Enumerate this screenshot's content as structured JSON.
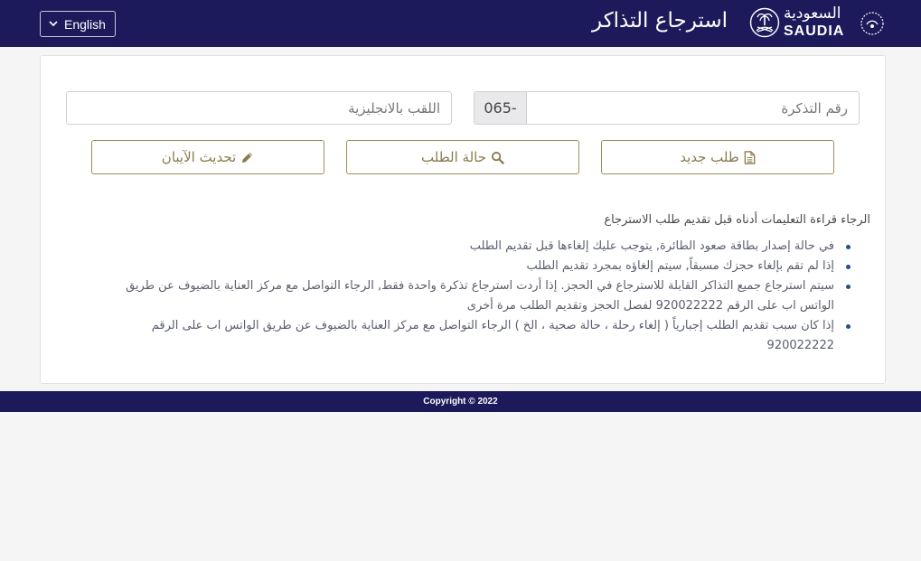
{
  "header": {
    "language_button": "English",
    "page_title": "استرجاع التذاكر",
    "logo_arabic": "السعودية",
    "logo_english": "SAUDIA"
  },
  "form": {
    "surname_placeholder": "اللقب بالانجليزية",
    "ticket_prefix": "065-",
    "ticket_placeholder": "رقم التذكرة"
  },
  "buttons": {
    "new_request": "طلب جديد",
    "request_status": "حالة الطلب",
    "update_iban": "تحديث الآيبان"
  },
  "instructions": {
    "intro": "الرجاء قراءة التعليمات أدناه قبل تقديم طلب الاسترجاع",
    "items": [
      "في حالة إصدار بطاقة صعود الطائرة, يتوجب عليك إلغاءها قبل تقديم الطلب",
      "إذا لم تقم بإلغاء حجزك مسبقاً, سيتم إلغاؤه بمجرد تقديم الطلب",
      "سيتم استرجاع جميع التذاكر القابلة للاسترجاع في الحجز. إذا أردت استرجاع تذكرة واحدة فقط, الرجاء التواصل مع مركز العناية بالضيوف عن طريق الواتس اب على الرقم 920022222 لفصل الحجز وتقديم الطلب مرة أخرى",
      "إذا كان سبب تقديم الطلب إجبارياً ( إلغاء رحلة ، حالة صحية ، الخ ) الرجاء التواصل مع مركز العناية بالضيوف عن طريق الواتس اب على الرقم 920022222"
    ]
  },
  "footer": {
    "copyright": "Copyright © 2022"
  },
  "colors": {
    "navy": "#1d1a5b",
    "gold": "#9c8d5e"
  }
}
